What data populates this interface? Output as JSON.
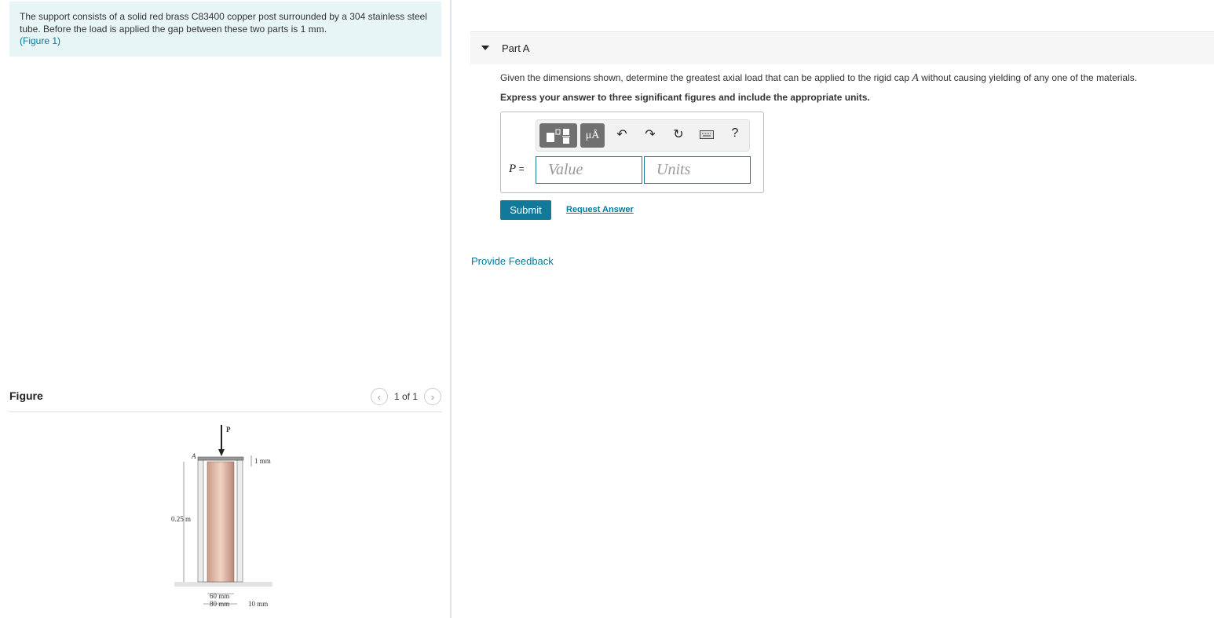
{
  "problem": {
    "text": "The support consists of a solid red brass C83400 copper post surrounded by a 304 stainless steel tube. Before the load is applied the gap between these two parts is 1",
    "unit": "mm",
    "suffix": ".",
    "figure_link": "(Figure 1)"
  },
  "figure": {
    "title": "Figure",
    "pager": "1 of 1",
    "labels": {
      "load": "P",
      "cap": "A",
      "gap": "1 mm",
      "height": "0.25 m",
      "inner": "60 mm",
      "outer": "80 mm",
      "thickness": "10 mm"
    }
  },
  "part": {
    "title": "Part A",
    "question_pre": "Given the dimensions shown, determine the greatest axial load that can be applied to the rigid cap",
    "question_var": "A",
    "question_post": "without causing yielding of any one of the materials.",
    "instruction": "Express your answer to three significant figures and include the appropriate units.",
    "toolbar": {
      "units_button": "μÅ",
      "help": "?"
    },
    "answer_label": "P",
    "equals": "=",
    "value_placeholder": "Value",
    "units_placeholder": "Units",
    "submit": "Submit",
    "request_answer": "Request Answer"
  },
  "feedback": "Provide Feedback",
  "colors": {
    "accent": "#117a9a",
    "link": "#007c9e",
    "intro_bg": "#e8f5f7"
  }
}
